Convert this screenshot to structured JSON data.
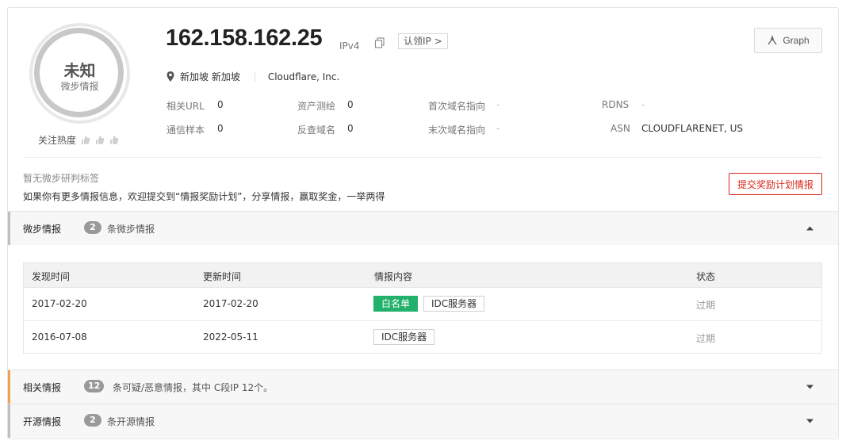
{
  "gauge": {
    "verdict": "未知",
    "source": "微步情报",
    "heat_label": "关注热度",
    "heat_level": 0
  },
  "header": {
    "ip": "162.158.162.25",
    "ip_version": "IPv4",
    "claim_label": "认领IP >",
    "graph_label": "Graph",
    "location": "新加坡 新加坡",
    "isp": "Cloudflare, Inc."
  },
  "meta": [
    {
      "label": "相关URL",
      "value": "0"
    },
    {
      "label": "资产测绘",
      "value": "0"
    },
    {
      "label": "首次域名指向",
      "value": "-"
    },
    {
      "label": "RDNS",
      "value": "-"
    },
    {
      "label": "通信样本",
      "value": "0"
    },
    {
      "label": "反查域名",
      "value": "0"
    },
    {
      "label": "末次域名指向",
      "value": "-"
    },
    {
      "label": "ASN",
      "value": "CLOUDFLARENET, US"
    }
  ],
  "tags": {
    "none_text": "暂无微步研判标签",
    "tip_text": "如果你有更多情报信息，欢迎提交到“情报奖励计划”，分享情报，赢取奖金，一举两得",
    "submit_label": "提交奖励计划情报"
  },
  "sections": [
    {
      "title": "微步情报",
      "count": "2",
      "desc": "条微步情报",
      "expanded": true,
      "accent": "#bfbfbf"
    },
    {
      "title": "相关情报",
      "count": "12",
      "desc": "条可疑/恶意情报，其中 C段IP 12个。",
      "expanded": false,
      "accent": "#f0a050"
    },
    {
      "title": "开源情报",
      "count": "2",
      "desc": "条开源情报",
      "expanded": false,
      "accent": "#bfbfbf"
    }
  ],
  "table": {
    "headers": [
      "发现时间",
      "更新时间",
      "情报内容",
      "状态"
    ],
    "rows": [
      {
        "found": "2017-02-20",
        "updated": "2017-02-20",
        "tags": [
          "白名单",
          "IDC服务器"
        ],
        "status": "过期"
      },
      {
        "found": "2016-07-08",
        "updated": "2022-05-11",
        "tags": [
          "IDC服务器"
        ],
        "status": "过期"
      }
    ]
  },
  "colors": {
    "whitelist_tag": "#21b16a",
    "submit_red": "#d9281c",
    "related_accent": "#f0a050"
  },
  "icons": [
    "location-pin-icon",
    "copy-icon",
    "graph-icon",
    "thumb-icon",
    "caret-up-icon",
    "caret-down-icon"
  ]
}
